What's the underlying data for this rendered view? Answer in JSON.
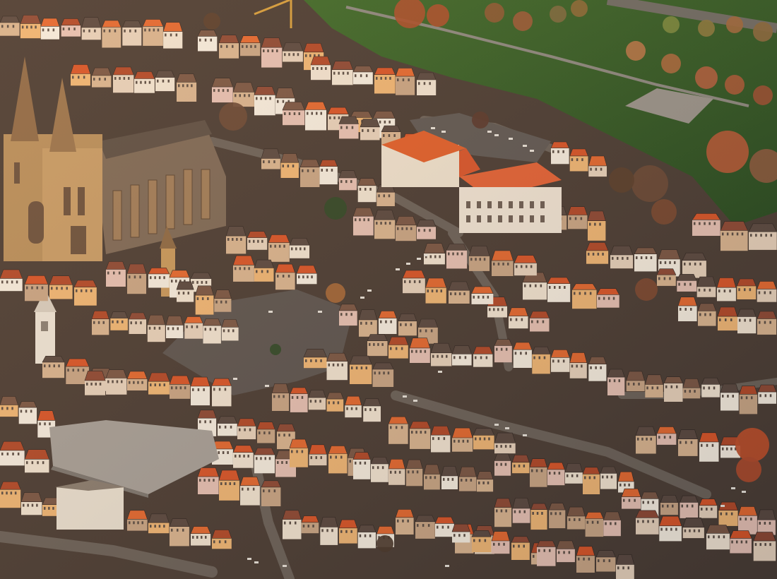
{
  "image": {
    "kind": "aerial photograph",
    "palette": {
      "meadow": "#2f5a2a",
      "meadow_light": "#4a7a35",
      "street": "#6c6560",
      "square": "#5d5755",
      "roof_red": "#d8562c",
      "roof_orange": "#e46a34",
      "roof_dark": "#5a4a44",
      "roof_brown": "#7a5848",
      "wall_white": "#f2e6d6",
      "wall_sunlit": "#f0b879",
      "cathedral": "#b38a5f",
      "cathedral_shadow": "#6e5a48",
      "tree_autumn": "#a9502f",
      "tree_green": "#2d3a22",
      "shadow": "#2e2624"
    }
  }
}
